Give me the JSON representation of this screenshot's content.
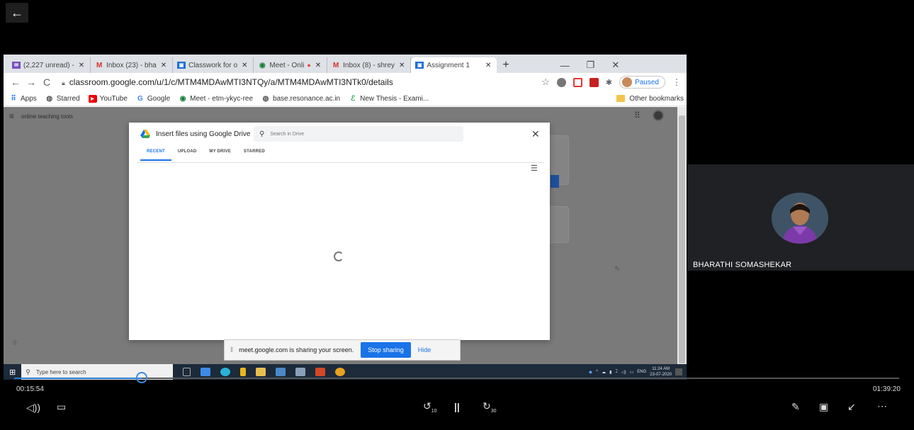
{
  "browser": {
    "tabs": [
      {
        "icon": "mail-icon",
        "label": "(2,227 unread) -"
      },
      {
        "icon": "gmail-icon",
        "label": "Inbox (23) - bha"
      },
      {
        "icon": "classroom-icon",
        "label": "Classwork for o"
      },
      {
        "icon": "meet-icon",
        "label": "Meet - Onli"
      },
      {
        "icon": "gmail-icon",
        "label": "Inbox (8) - shrey"
      },
      {
        "icon": "classroom-icon",
        "label": "Assignment 1"
      }
    ],
    "url": "classroom.google.com/u/1/c/MTM4MDAwMTI3NTQy/a/MTM4MDAwMTI3NTk0/details",
    "paused": "Paused",
    "bookmarks": [
      "Apps",
      "Starred",
      "YouTube",
      "Google",
      "Meet - etm-ykyc-ree",
      "base.resonance.ac.in",
      "New Thesis - Exami..."
    ],
    "other_bookmarks": "Other bookmarks"
  },
  "page": {
    "class_title": "online teaching tools"
  },
  "dialog": {
    "title": "Insert files using Google Drive",
    "search_placeholder": "Search in Drive",
    "tabs": [
      "RECENT",
      "UPLOAD",
      "MY DRIVE",
      "STARRED"
    ]
  },
  "sharing": {
    "message": "meet.google.com is sharing your screen.",
    "stop": "Stop sharing",
    "hide": "Hide"
  },
  "taskbar": {
    "search_placeholder": "Type here to search",
    "lang": "ENG",
    "time": "11:24 AM",
    "date": "23-07-2020"
  },
  "participant": {
    "name": "BHARATHI SOMASHEKAR"
  },
  "player": {
    "current_time": "00:15:54",
    "total_time": "01:39:20",
    "progress": 0.144,
    "skip_back": "10",
    "skip_fwd": "30"
  }
}
